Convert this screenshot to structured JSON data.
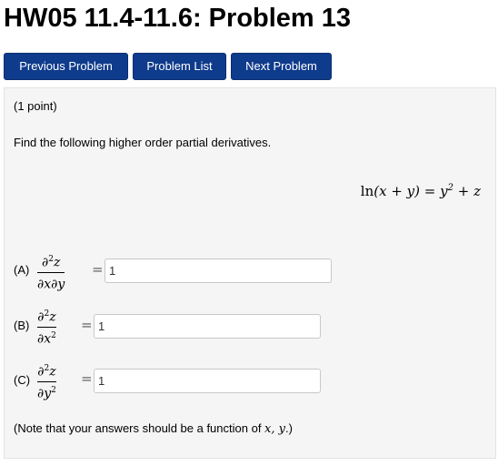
{
  "page": {
    "title": "HW05 11.4-11.6: Problem 13"
  },
  "nav": {
    "previous_label": "Previous Problem",
    "list_label": "Problem List",
    "next_label": "Next Problem"
  },
  "problem": {
    "points": "(1 point)",
    "prompt": "Find the following higher order partial derivatives.",
    "equation": {
      "lhs_fn": "ln",
      "lhs_arg": "(x + y)",
      "rhs": "= y",
      "rhs_exp": "2",
      "rhs_tail": " + z"
    },
    "parts": [
      {
        "label": "(A)",
        "num": "∂",
        "num_exp": "2",
        "num_var": "z",
        "den": "∂x∂y",
        "den_exp": "",
        "eq": "=",
        "answer": "1"
      },
      {
        "label": "(B)",
        "num": "∂",
        "num_exp": "2",
        "num_var": "z",
        "den": "∂x",
        "den_exp": "2",
        "eq": "=",
        "answer": "1"
      },
      {
        "label": "(C)",
        "num": "∂",
        "num_exp": "2",
        "num_var": "z",
        "den": "∂y",
        "den_exp": "2",
        "eq": "=",
        "answer": "1"
      }
    ],
    "note": {
      "prefix": "(Note that your answers should be a function of ",
      "vars": "x, y",
      "suffix": ".)"
    }
  }
}
